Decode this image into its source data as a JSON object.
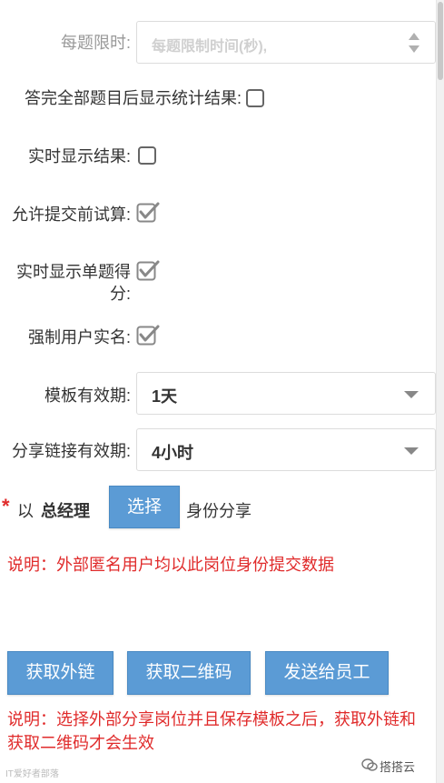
{
  "form": {
    "time_limit": {
      "label": "每题限时:",
      "placeholder": "每题限制时间(秒),"
    },
    "show_stats_after_all": {
      "label": "答完全部题目后显示统计结果:",
      "checked": false
    },
    "realtime_result": {
      "label": "实时显示结果:",
      "checked": false
    },
    "allow_trial_calc": {
      "label": "允许提交前试算:",
      "checked": true
    },
    "realtime_single_score": {
      "label": "实时显示单题得分:",
      "checked": true
    },
    "force_real_name": {
      "label": "强制用户实名:",
      "checked": true
    },
    "template_validity": {
      "label": "模板有效期:",
      "value": "1天"
    },
    "share_link_validity": {
      "label": "分享链接有效期:",
      "value": "4小时"
    }
  },
  "identity": {
    "required_mark": "*",
    "prefix": "以",
    "role": "总经理",
    "select_button": "选择",
    "suffix": "身份分享"
  },
  "note1": "说明：外部匿名用户均以此岗位身份提交数据",
  "buttons": {
    "get_external_link": "获取外链",
    "get_qrcode": "获取二维码",
    "send_to_staff": "发送给员工"
  },
  "note2": "说明：选择外部分享岗位并且保存模板之后，获取外链和获取二维码才会生效",
  "watermark_left": "IT爱好者部落",
  "watermark_right": "搭搭云",
  "colors": {
    "button_blue": "#5b9bd5",
    "note_red": "#e02b2b"
  }
}
